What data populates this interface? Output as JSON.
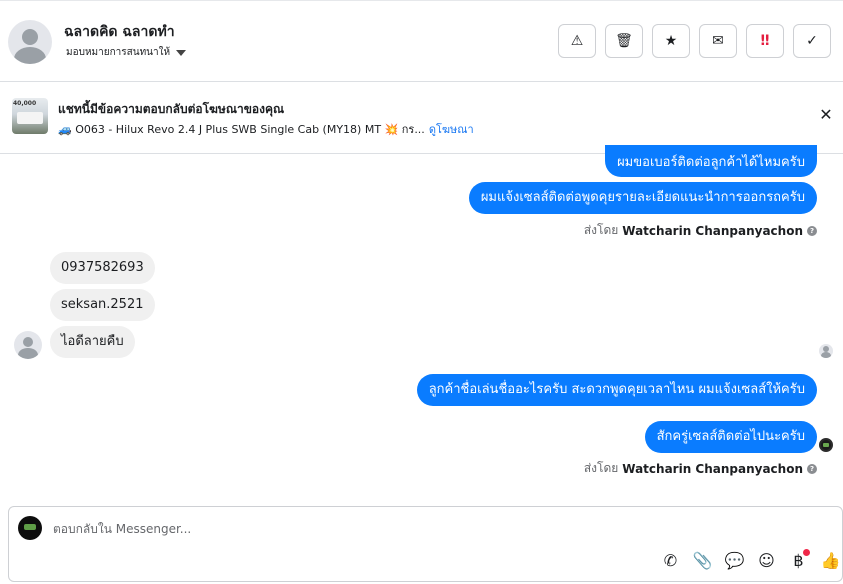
{
  "header": {
    "contact_name": "ฉลาดคิด ฉลาดทำ",
    "assign_label": "มอบหมายการสนทนาให้",
    "actions": [
      {
        "name": "spam-button",
        "icon": "warning-icon",
        "glyph": "⚠"
      },
      {
        "name": "delete-button",
        "icon": "trash-icon",
        "glyph": "🗑"
      },
      {
        "name": "star-button",
        "icon": "star-icon",
        "glyph": "★"
      },
      {
        "name": "mark-unread-button",
        "icon": "envelope-icon",
        "glyph": "✉"
      },
      {
        "name": "priority-button",
        "icon": "priority-icon",
        "glyph": "‼"
      },
      {
        "name": "done-button",
        "icon": "check-icon",
        "glyph": "✓"
      }
    ]
  },
  "banner": {
    "title": "แชทนี้มีข้อความตอบกลับต่อโฆษณาของคุณ",
    "ad_text": "🚙 O063 - Hilux Revo 2.4 J Plus SWB Single Cab (MY18) MT 💥 กร...",
    "link": "ดูโฆษณา",
    "thumb_label": "40,000"
  },
  "messages": {
    "out_1": "ผมขอเบอร์ติดต่อลูกค้าได้ไหมครับ",
    "out_2": "ผมแจ้งเซลส์ติดต่อพูดคุยรายละเอียดแนะนำการออกรถครับ",
    "sent_by_prefix": "ส่งโดย",
    "sent_by_name": "Watcharin Chanpanyachon",
    "in_1": "0937582693",
    "in_2": "seksan.2521",
    "in_3": "ไอดีลายคืบ",
    "out_3": "ลูกค้าชื่อเล่นชื่ออะไรครับ สะดวกพูดคุยเวลาไหน ผมแจ้งเซลส์ให้ครับ",
    "out_4": "สักครู่เซลส์ติดต่อไปนะครับ"
  },
  "composer": {
    "placeholder": "ตอบกลับใน Messenger...",
    "value": ""
  },
  "colors": {
    "outgoing_bubble": "#0a7cff",
    "incoming_bubble": "#f0f0f0",
    "link": "#1877f2",
    "danger": "#e41e3f"
  }
}
